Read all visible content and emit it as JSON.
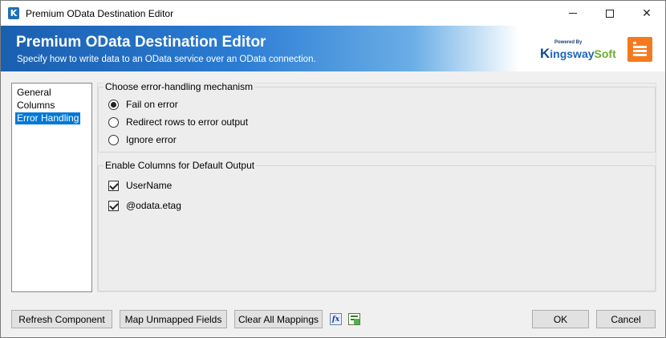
{
  "window": {
    "title": "Premium OData Destination Editor",
    "app_icon_letter": "K"
  },
  "banner": {
    "title": "Premium OData Destination Editor",
    "subtitle": "Specify how to write data to an OData service over an OData connection.",
    "brand_powered_by": "Powered By",
    "brand_name_k": "K",
    "brand_name_middle": "ingsway",
    "brand_name_end": "Soft",
    "icon": "editor-list-icon",
    "accent_color": "#f47a1f",
    "gradient_start": "#1a5fb0"
  },
  "nav": {
    "items": [
      {
        "label": "General",
        "active": false
      },
      {
        "label": "Columns",
        "active": false
      },
      {
        "label": "Error Handling",
        "active": true
      }
    ],
    "selected_color": "#0078d7"
  },
  "error_handling": {
    "legend": "Choose error-handling mechanism",
    "options": [
      {
        "label": "Fail on error",
        "selected": true
      },
      {
        "label": "Redirect rows to error output",
        "selected": false
      },
      {
        "label": "Ignore error",
        "selected": false
      }
    ]
  },
  "default_output": {
    "legend": "Enable Columns for Default Output",
    "columns": [
      {
        "label": "UserName",
        "checked": true
      },
      {
        "label": "@odata.etag",
        "checked": true
      }
    ]
  },
  "buttons": {
    "refresh": "Refresh Component",
    "map_unmapped": "Map Unmapped Fields",
    "clear_mappings": "Clear All Mappings",
    "expression_icon": "fx-expression-icon",
    "mapping_icon": "mapping-checklist-icon",
    "ok": "OK",
    "cancel": "Cancel"
  }
}
